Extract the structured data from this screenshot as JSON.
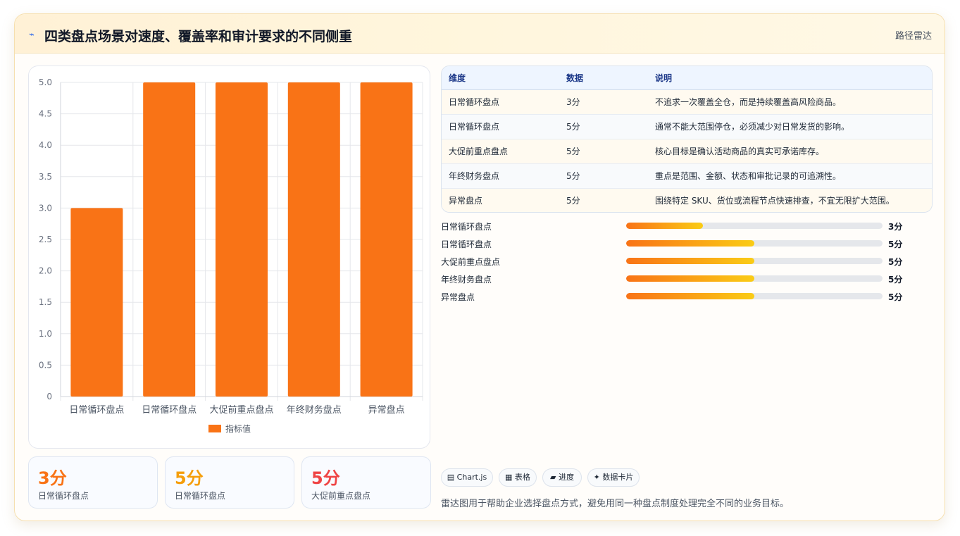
{
  "header": {
    "icon": "wave-icon",
    "icon_glyph": "⌁",
    "title": "四类盘点场景对速度、覆盖率和审计要求的不同侧重",
    "tag": "路径雷达"
  },
  "chart_data": {
    "type": "bar",
    "categories": [
      "日常循环盘点",
      "日常循环盘点",
      "大促前重点盘点",
      "年终财务盘点",
      "异常盘点"
    ],
    "series": [
      {
        "name": "指标值",
        "values": [
          3,
          5,
          5,
          5,
          5
        ],
        "color": "#f97316"
      }
    ],
    "ylim": [
      0,
      5
    ],
    "yticks": [
      "0",
      "0.5",
      "1.0",
      "1.5",
      "2.0",
      "2.5",
      "3.0",
      "3.5",
      "4.0",
      "4.5",
      "5.0"
    ],
    "grid": true,
    "legend": "bottom"
  },
  "stats": [
    {
      "value": "3分",
      "label": "日常循环盘点",
      "color": "#f97316"
    },
    {
      "value": "5分",
      "label": "日常循环盘点",
      "color": "#f59e0b"
    },
    {
      "value": "5分",
      "label": "大促前重点盘点",
      "color": "#ef4444"
    }
  ],
  "table": {
    "headers": [
      "维度",
      "数据",
      "说明"
    ],
    "rows": [
      [
        "日常循环盘点",
        "3分",
        "不追求一次覆盖全仓，而是持续覆盖高风险商品。"
      ],
      [
        "日常循环盘点",
        "5分",
        "通常不能大范围停仓，必须减少对日常发货的影响。"
      ],
      [
        "大促前重点盘点",
        "5分",
        "核心目标是确认活动商品的真实可承诺库存。"
      ],
      [
        "年终财务盘点",
        "5分",
        "重点是范围、金额、状态和审批记录的可追溯性。"
      ],
      [
        "异常盘点",
        "5分",
        "围绕特定 SKU、货位或流程节点快速排查，不宜无限扩大范围。"
      ]
    ]
  },
  "progress": [
    {
      "label": "日常循环盘点",
      "value": "3分",
      "fraction": 0.3
    },
    {
      "label": "日常循环盘点",
      "value": "5分",
      "fraction": 0.5
    },
    {
      "label": "大促前重点盘点",
      "value": "5分",
      "fraction": 0.5
    },
    {
      "label": "年终财务盘点",
      "value": "5分",
      "fraction": 0.5
    },
    {
      "label": "异常盘点",
      "value": "5分",
      "fraction": 0.5
    }
  ],
  "chips": [
    "▤ Chart.js",
    "▦ 表格",
    "▰ 进度",
    "✦ 数据卡片"
  ],
  "footnote": "雷达图用于帮助企业选择盘点方式，避免用同一种盘点制度处理完全不同的业务目标。"
}
